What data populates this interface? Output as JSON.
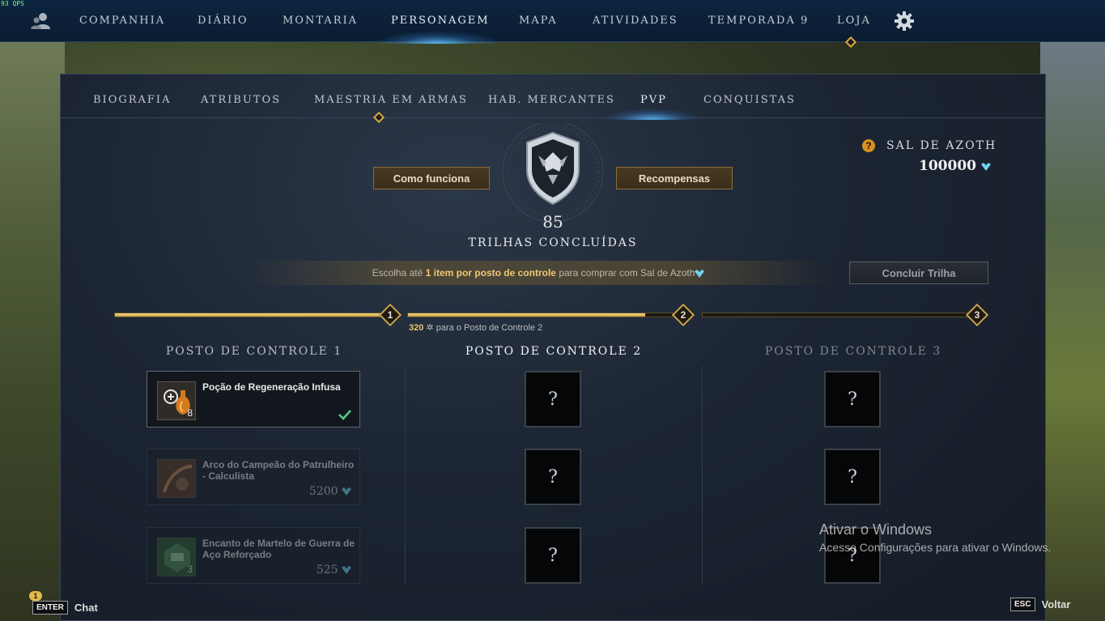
{
  "overlay": {
    "fps": "93 QPS"
  },
  "topnav": {
    "items": [
      {
        "label": "COMPANHIA",
        "active": false
      },
      {
        "label": "DIÁRIO",
        "active": false
      },
      {
        "label": "MONTARIA",
        "active": false
      },
      {
        "label": "PERSONAGEM",
        "active": true
      },
      {
        "label": "MAPA",
        "active": false
      },
      {
        "label": "ATIVIDADES",
        "active": false
      },
      {
        "label": "TEMPORADA 9",
        "active": false
      },
      {
        "label": "LOJA",
        "active": false
      }
    ],
    "social_icon": "social-icon",
    "settings_icon": "gear-icon"
  },
  "subnav": {
    "items": [
      {
        "label": "BIOGRAFIA",
        "active": false
      },
      {
        "label": "ATRIBUTOS",
        "active": false
      },
      {
        "label": "MAESTRIA EM ARMAS",
        "active": false
      },
      {
        "label": "HAB. MERCANTES",
        "active": false
      },
      {
        "label": "PVP",
        "active": true
      },
      {
        "label": "CONQUISTAS",
        "active": false
      }
    ]
  },
  "pvp": {
    "how_it_works": "Como funciona",
    "rewards": "Recompensas",
    "rank_number": "85",
    "rank_label": "TRILHAS CONCLUÍDAS",
    "azoth": {
      "label": "SAL DE AZOTH",
      "value": "100000",
      "help": "?"
    },
    "info_banner": {
      "prefix": "Escolha até ",
      "bold": "1 item por posto de controle",
      "suffix": " para comprar com Sal de Azoth"
    },
    "conclude_button": "Concluir Trilha",
    "track": {
      "checkpoints": [
        "1",
        "2",
        "3"
      ],
      "segment_progress": [
        1.0,
        0.9,
        0.0
      ],
      "note_value": "320",
      "note_text": "para o Posto de Controle 2"
    },
    "columns": [
      {
        "title": "POSTO DE CONTROLE 1",
        "state": "completed"
      },
      {
        "title": "POSTO DE CONTROLE 2",
        "state": "current"
      },
      {
        "title": "POSTO DE CONTROLE 3",
        "state": "locked"
      }
    ],
    "checkpoint1_items": [
      {
        "name": "Poção de Regeneração Infusa",
        "qty": "8",
        "price": "",
        "selected": true,
        "icon": "potion-icon"
      },
      {
        "name": "Arco do Campeão do Patrulheiro - Calculista",
        "qty": "",
        "price": "5200",
        "selected": false,
        "icon": "bow-icon"
      },
      {
        "name": "Encanto de Martelo de Guerra de Aço Reforçado",
        "qty": "3",
        "price": "525",
        "selected": false,
        "icon": "warhammer-charm-icon"
      }
    ],
    "mystery_label": "?"
  },
  "windows_activation": {
    "title": "Ativar o Windows",
    "subtitle": "Acesse Configurações para ativar o Windows."
  },
  "footer": {
    "chat_key": "ENTER",
    "chat_label": "Chat",
    "notification_count": "1",
    "back_key": "ESC",
    "back_label": "Voltar"
  },
  "colors": {
    "accent_gold": "#caa24e",
    "active_glow": "#5abeff",
    "azoth_gem": "#6fd3f0",
    "check_green": "#4fd18a"
  }
}
